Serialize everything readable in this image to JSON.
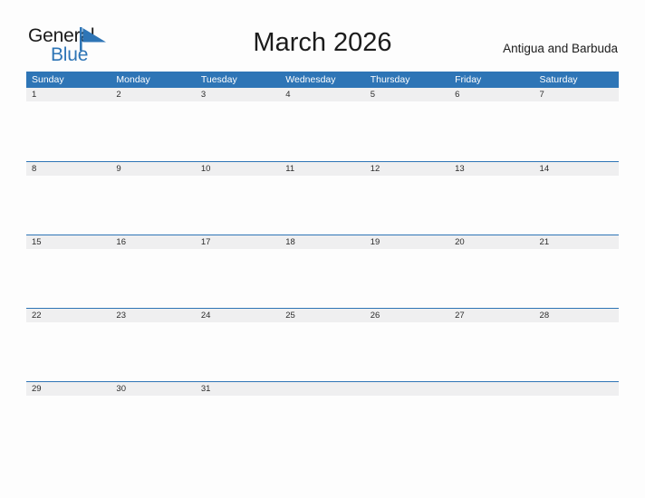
{
  "logo": {
    "word_one": "General",
    "word_two": "Blue",
    "mark_icon": "triangle-flag-icon",
    "blue_hex": "#2e75b6"
  },
  "header": {
    "title": "March 2026",
    "region": "Antigua and Barbuda"
  },
  "calendar": {
    "month": "March",
    "year": "2026",
    "header_bg_hex": "#2e75b6",
    "band_bg_hex": "#efeff0",
    "rule_hex": "#2e75b6",
    "weekdays": [
      "Sunday",
      "Monday",
      "Tuesday",
      "Wednesday",
      "Thursday",
      "Friday",
      "Saturday"
    ],
    "weeks": [
      [
        "1",
        "2",
        "3",
        "4",
        "5",
        "6",
        "7"
      ],
      [
        "8",
        "9",
        "10",
        "11",
        "12",
        "13",
        "14"
      ],
      [
        "15",
        "16",
        "17",
        "18",
        "19",
        "20",
        "21"
      ],
      [
        "22",
        "23",
        "24",
        "25",
        "26",
        "27",
        "28"
      ],
      [
        "29",
        "30",
        "31",
        "",
        "",
        "",
        ""
      ]
    ]
  }
}
